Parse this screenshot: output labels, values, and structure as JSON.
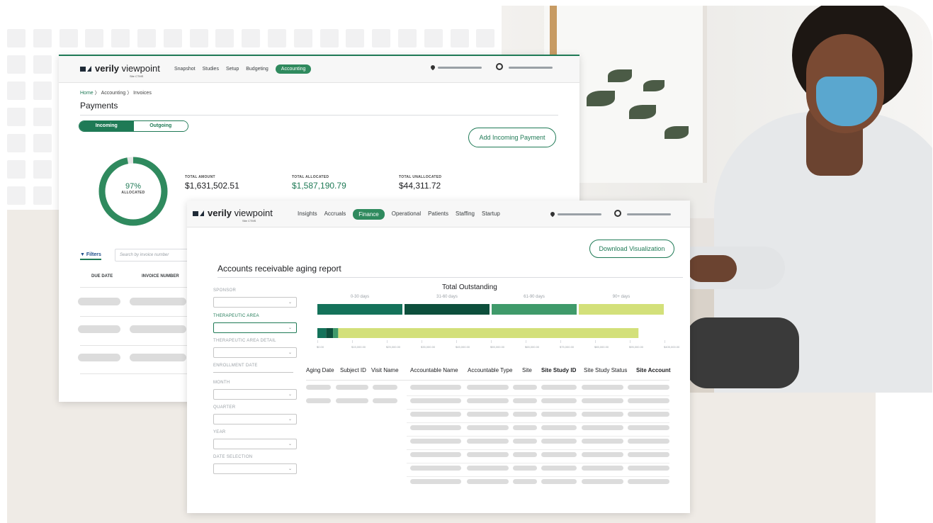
{
  "colors": {
    "accent": "#1f7a56",
    "bar_0_30": "#14725a",
    "bar_31_60": "#0d4f3c",
    "bar_61_90": "#3f9a6a",
    "bar_90_plus": "#d3e07a",
    "donut_bg": "#e6e6e6",
    "skeleton": "#dcdcdc"
  },
  "payments_window": {
    "logo": {
      "brand": "verily",
      "product": "viewpoint",
      "sub": "Site CTMS"
    },
    "nav": [
      "Snapshot",
      "Studies",
      "Setup",
      "Budgeting",
      "Accounting"
    ],
    "nav_active": "Accounting",
    "icons": {
      "location": "location-pin-icon",
      "user": "user-circle-icon"
    },
    "breadcrumb": {
      "home": "Home",
      "sep1": "〉",
      "accounting": "Accounting",
      "sep2": "〉",
      "invoices": "Invoices"
    },
    "title": "Payments",
    "toggle": {
      "incoming": "Incoming",
      "outgoing": "Outgoing",
      "selected": "Incoming"
    },
    "add_button": "Add Incoming Payment",
    "donut": {
      "percent_label": "97%",
      "label": "ALLOCATED",
      "fraction": 0.97
    },
    "stats": {
      "total_amount_label": "TOTAL AMOUNT",
      "total_amount": "$1,631,502.51",
      "total_allocated_label": "TOTAL ALLOCATED",
      "total_allocated": "$1,587,190.79",
      "total_unallocated_label": "TOTAL UNALLOCATED",
      "total_unallocated": "$44,311.72"
    },
    "filters_label": "Filters",
    "search_placeholder": "Search by invoice number",
    "columns": [
      "DUE DATE",
      "INVOICE NUMBER"
    ]
  },
  "finance_window": {
    "logo": {
      "brand": "verily",
      "product": "viewpoint",
      "sub": "Site CTMS"
    },
    "nav": [
      "Insights",
      "Accruals",
      "Finance",
      "Operational",
      "Patients",
      "Staffing",
      "Startup"
    ],
    "nav_active": "Finance",
    "download_button": "Download Visualization",
    "title": "Accounts receivable aging report",
    "filters": [
      {
        "label": "SPONSOR",
        "type": "select",
        "active": false
      },
      {
        "label": "THERAPEUTIC AREA",
        "type": "select",
        "active": true
      },
      {
        "label": "THERAPEUTIC AREA DETAIL",
        "type": "select",
        "active": false
      },
      {
        "label": "ENROLLMENT DATE",
        "type": "slider",
        "active": false
      },
      {
        "label": "MONTH",
        "type": "select",
        "active": false
      },
      {
        "label": "QUARTER",
        "type": "select",
        "active": false
      },
      {
        "label": "YEAR",
        "type": "select",
        "active": false
      },
      {
        "label": "DATE SELECTION",
        "type": "select",
        "active": false
      }
    ],
    "columns": [
      "Aging Date",
      "Subject ID",
      "Visit Name",
      "Accountable Name",
      "Accountable Type",
      "Site",
      "Site Study ID",
      "Site Study Status",
      "Site Account"
    ],
    "bold_columns": [
      "Site Study ID",
      "Site Account"
    ]
  },
  "chart_data": {
    "type": "bar",
    "title": "Total Outstanding",
    "categories": [
      "0-30 days",
      "31-60 days",
      "61-90 days",
      "90+ days"
    ],
    "stacked_bar": [
      {
        "bucket": "0-30 days",
        "value": 5000
      },
      {
        "bucket": "31-60 days",
        "value": 4000
      },
      {
        "bucket": "61-90 days",
        "value": 3000
      },
      {
        "bucket": "90+ days",
        "value": 173000
      }
    ],
    "x_ticks": [
      "$0.00",
      "$15,000.00",
      "$25,000.00",
      "$35,000.00",
      "$45,000.00",
      "$55,000.00",
      "$65,000.00",
      "$75,000.00",
      "$85,000.00",
      "$95,000.00",
      "$405,000.00"
    ],
    "xlim": [
      0,
      200000
    ]
  }
}
